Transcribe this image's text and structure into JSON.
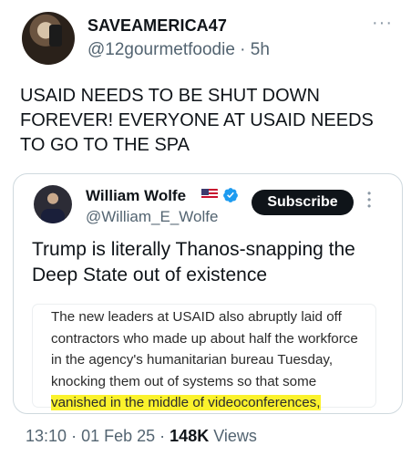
{
  "post": {
    "display_name": "SAVEAMERICA47",
    "handle": "@12gourmetfoodie",
    "age": "· 5h",
    "text": "USAID NEEDS TO BE SHUT DOWN FOREVER! EVERYONE AT USAID NEEDS TO GO TO THE SPA"
  },
  "quote": {
    "display_name": "William Wolfe",
    "handle": "@William_E_Wolfe",
    "subscribe_label": "Subscribe",
    "text": "Trump is literally Thanos-snapping the Deep State out of existence",
    "excerpt": {
      "pre": "The new leaders at USAID also abruptly laid off contractors who made up about half the workforce in the agency's humanitarian bureau Tuesday, knocking them out of systems so that some ",
      "highlight": "vanished in the middle of videoconferences,"
    }
  },
  "meta": {
    "time": "13:10",
    "date": "01 Feb 25",
    "views_count": "148K",
    "views_label": "Views"
  },
  "colors": {
    "verified": "#1d9bf0",
    "highlight": "#fbf22c",
    "secondary_text": "#536471"
  }
}
